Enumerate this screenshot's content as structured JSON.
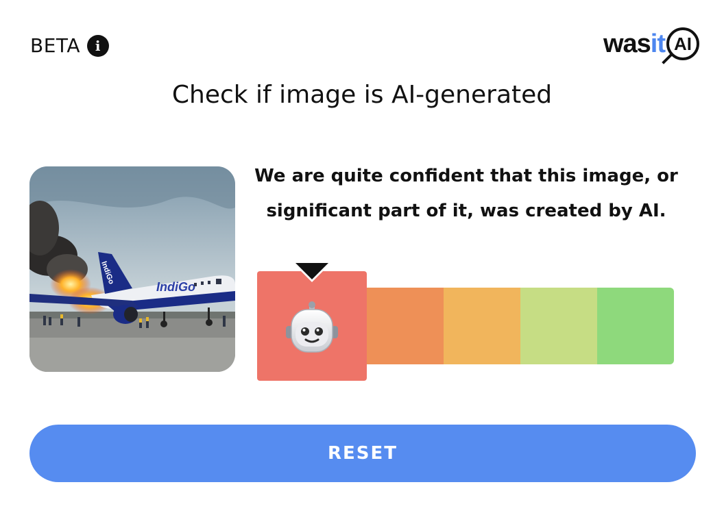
{
  "header": {
    "beta_label": "BETA",
    "info_icon": "info-icon",
    "logo": {
      "part_a": "was",
      "part_b": "it",
      "part_c": "AI"
    }
  },
  "title": "Check if image is AI-generated",
  "result": {
    "verdict_line1": "We are quite confident that this image, or",
    "verdict_line2": "significant part of it, was created by AI.",
    "meter": {
      "level_count": 5,
      "selected_level": 1,
      "selected_icon": "robot-face-icon",
      "colors": [
        "#ee7468",
        "#ee9057",
        "#f1b55c",
        "#c6dd84",
        "#8ed97c"
      ]
    }
  },
  "actions": {
    "reset_label": "RESET"
  },
  "colors": {
    "accent": "#568cf0",
    "logo_blue": "#4d86ef"
  }
}
